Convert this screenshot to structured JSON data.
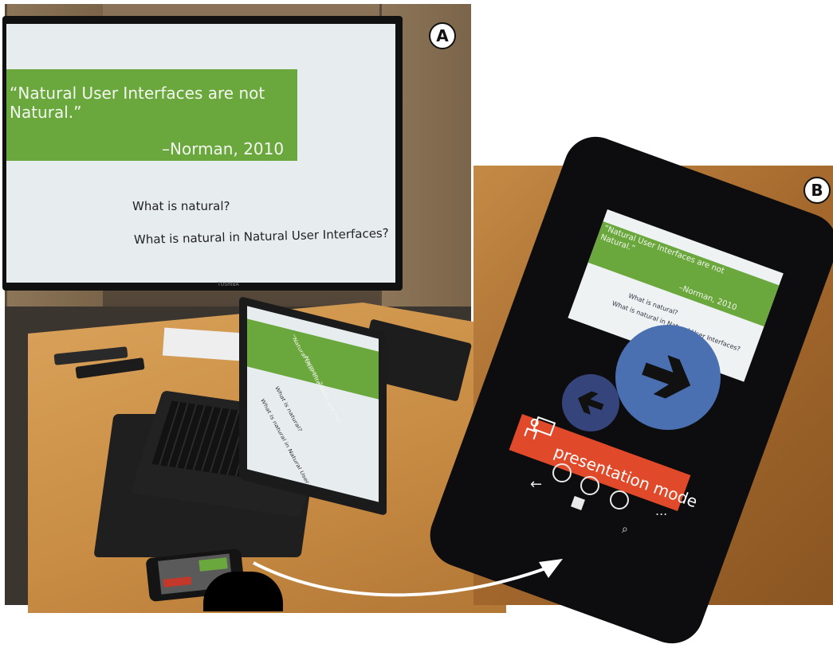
{
  "panels": {
    "a_label": "A",
    "b_label": "B"
  },
  "tv_slide": {
    "quote": "“Natural User Interfaces are not\nNatural.”",
    "author": "–Norman, 2010",
    "question1": "What is natural?",
    "question2": "What is natural in Natural User Interfaces?",
    "brand": "TOSHIBA"
  },
  "laptop_slide": {
    "quote": "“Natural User Interfaces are not",
    "author": "–Norman, 2010",
    "question1": "What is natural?",
    "question2": "What is natural in Natural User Interfaces?"
  },
  "phone_app": {
    "slide": {
      "quote": "“Natural User Interfaces are not\nNatural.”",
      "author": "–Norman, 2010",
      "question1": "What is natural?",
      "question2": "What is natural in Natural User Interfaces?"
    },
    "next_icon": "arrow-right-icon",
    "prev_icon": "arrow-left-icon",
    "mode_label": "presentation mode",
    "mode_icon": "presenter-icon",
    "appbar_icons": [
      "skype-icon",
      "info-icon",
      "keyboard-icon"
    ],
    "more_label": "...",
    "nav": [
      "back-icon",
      "windows-icon",
      "search-icon"
    ]
  },
  "colors": {
    "slide_green": "#6aa83d",
    "next_button": "#4a70b1",
    "prev_button": "#35447a",
    "mode_bar": "#e04a2a"
  }
}
